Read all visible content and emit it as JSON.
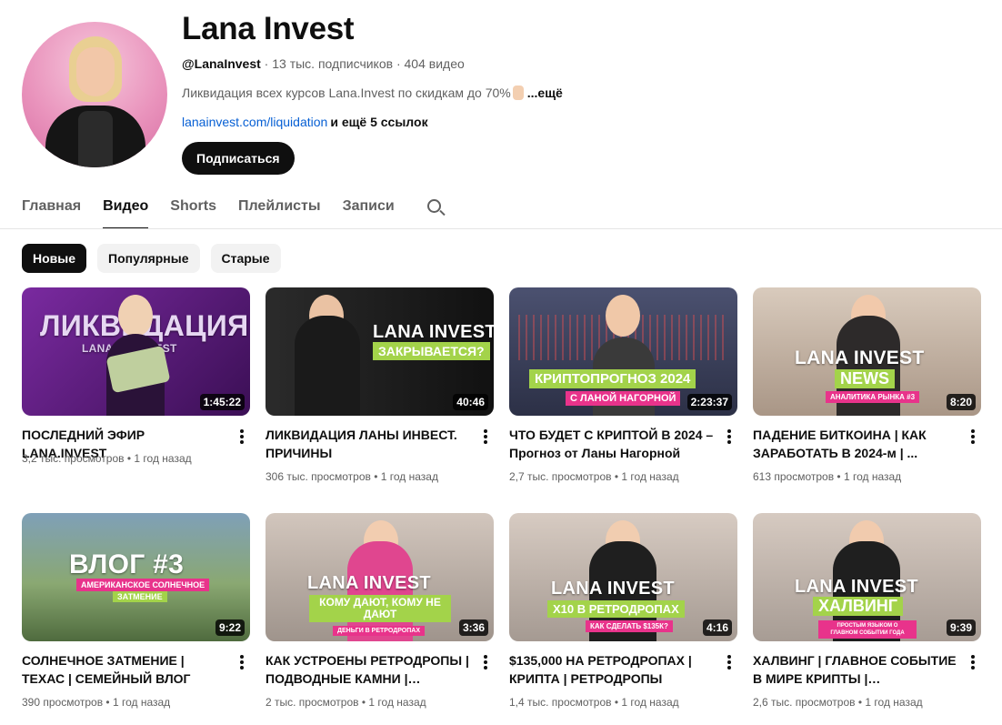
{
  "channel": {
    "name": "Lana Invest",
    "handle": "@LanaInvest",
    "subscribers": "13 тыс. подписчиков",
    "videos_count": "404 видео",
    "separator": " · ",
    "description": "Ликвидация всех курсов Lana.Invest по скидкам до 70%",
    "more_label": "...ещё",
    "link": "lanainvest.com/liquidation",
    "extra_links": "и ещё 5 ссылок",
    "subscribe_label": "Подписаться"
  },
  "tabs": [
    {
      "label": "Главная",
      "active": false
    },
    {
      "label": "Видео",
      "active": true
    },
    {
      "label": "Shorts",
      "active": false
    },
    {
      "label": "Плейлисты",
      "active": false
    },
    {
      "label": "Записи",
      "active": false
    }
  ],
  "chips": [
    {
      "label": "Новые",
      "active": true
    },
    {
      "label": "Популярные",
      "active": false
    },
    {
      "label": "Старые",
      "active": false
    }
  ],
  "videos": [
    {
      "title": "ПОСЛЕДНИЙ ЭФИР LANA.INVEST",
      "views": "3,2 тыс. просмотров",
      "age": "1 год назад",
      "duration": "1:45:22",
      "thumb_text": "ЛИКВИДАЦИЯ",
      "thumb_sub": "LANA       INVEST",
      "bg": "#5a1a7a"
    },
    {
      "title": "ЛИКВИДАЦИЯ ЛАНЫ ИНВЕСТ. ПРИЧИНЫ",
      "views": "306 тыс. просмотров",
      "age": "1 год назад",
      "duration": "40:46",
      "thumb_text": "LANA INVEST",
      "thumb_sub": "ЗАКРЫВАЕТСЯ?",
      "bg": "#1d1d1d"
    },
    {
      "title": "ЧТО БУДЕТ С КРИПТОЙ В 2024 – Прогноз от Ланы Нагорной",
      "views": "2,7 тыс. просмотров",
      "age": "1 год назад",
      "duration": "2:23:37",
      "thumb_text": "КРИПТОПРОГНОЗ 2024",
      "thumb_sub": "С ЛАНОЙ НАГОРНОЙ",
      "bg": "#3a3f57"
    },
    {
      "title": "ПАДЕНИЕ БИТКОИНА | КАК ЗАРАБОТАТЬ В 2024-м | ...",
      "views": "613 просмотров",
      "age": "1 год назад",
      "duration": "8:20",
      "thumb_text": "LANA INVEST",
      "thumb_sub": "NEWS",
      "thumb_tag": "АНАЛИТИКА РЫНКА #3",
      "bg": "#c9b8a8"
    },
    {
      "title": "СОЛНЕЧНОЕ ЗАТМЕНИЕ | ТЕХАС | СЕМЕЙНЫЙ ВЛОГ",
      "views": "390 просмотров",
      "age": "1 год назад",
      "duration": "9:22",
      "thumb_text": "ВЛОГ #3",
      "thumb_sub": "АМЕРИКАНСКОЕ СОЛНЕЧНОЕ",
      "thumb_tag": "ЗАТМЕНИЕ",
      "bg": "#6f8a5c"
    },
    {
      "title": "КАК УСТРОЕНЫ РЕТРОДРОПЫ | ПОДВОДНЫЕ КАМНИ | УСЛОВИЯ...",
      "views": "2 тыс. просмотров",
      "age": "1 год назад",
      "duration": "3:36",
      "thumb_text": "LANA INVEST",
      "thumb_sub": "КОМУ ДАЮТ, КОМУ НЕ ДАЮТ",
      "thumb_tag": "ДЕНЬГИ В РЕТРОДРОПАХ",
      "bg": "#b9ada5"
    },
    {
      "title": "$135,000 НА РЕТРОДРОПАХ | КРИПТА | РЕТРОДРОПЫ",
      "views": "1,4 тыс. просмотров",
      "age": "1 год назад",
      "duration": "4:16",
      "thumb_text": "LANA INVEST",
      "thumb_sub": "X10 В РЕТРОДРОПАХ",
      "thumb_tag": "КАК СДЕЛАТЬ $135К?",
      "bg": "#bdb2aa"
    },
    {
      "title": "ХАЛВИНГ | ГЛАВНОЕ СОБЫТИЕ В МИРЕ КРИПТЫ | КОРРЕКЦИЯ...",
      "views": "2,6 тыс. просмотров",
      "age": "1 год назад",
      "duration": "9:39",
      "thumb_text": "LANA INVEST",
      "thumb_sub": "ХАЛВИНГ",
      "thumb_tag": "ПРОСТЫМ ЯЗЫКОМ О ГЛАВНОМ СОБЫТИИ ГОДА",
      "bg": "#c3b6ac"
    }
  ],
  "colors": {
    "accent_green": "#a3d34a",
    "accent_pink": "#e8338b",
    "link_blue": "#065fd4"
  }
}
